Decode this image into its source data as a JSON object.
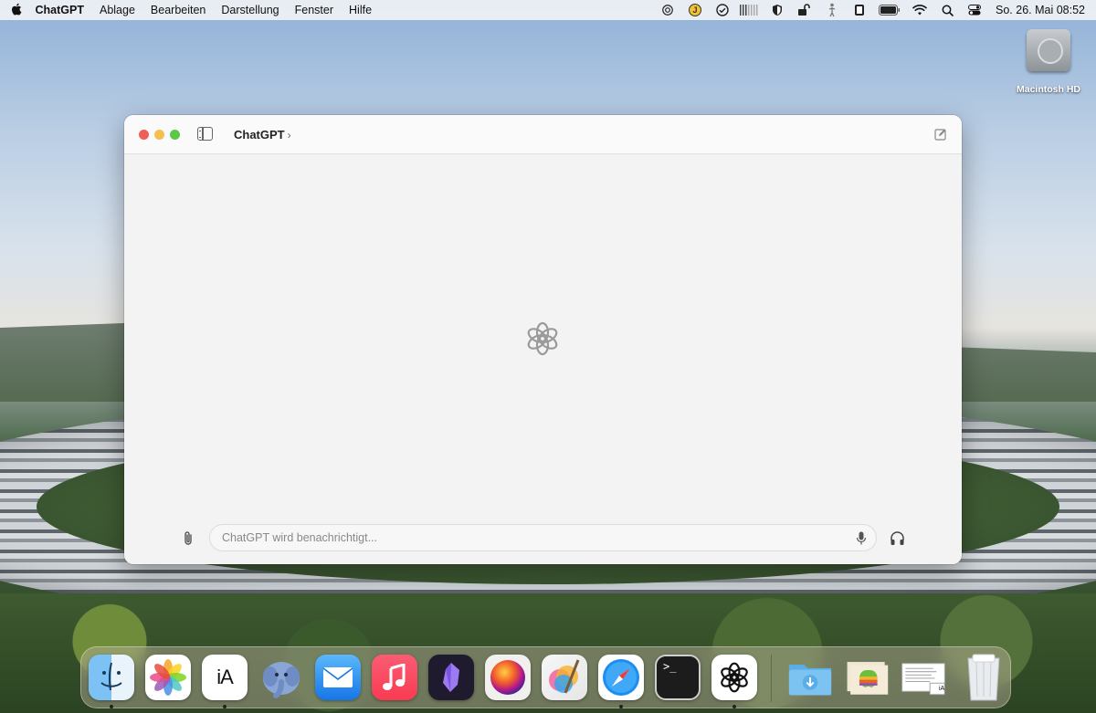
{
  "menubar": {
    "app_name": "ChatGPT",
    "items": [
      "Ablage",
      "Bearbeiten",
      "Darstellung",
      "Fenster",
      "Hilfe"
    ],
    "status_badge": "J",
    "clock": "So. 26. Mai  08:52"
  },
  "desktop": {
    "disk_label": "Macintosh HD"
  },
  "window": {
    "title": "ChatGPT",
    "title_chevron": "›",
    "composer_placeholder": "ChatGPT wird benachrichtigt..."
  },
  "dock": {
    "apps": [
      {
        "name": "Finder",
        "icon": "finder-icon",
        "running": true
      },
      {
        "name": "Fotos",
        "icon": "photos-icon",
        "running": false
      },
      {
        "name": "iA Writer",
        "icon": "ia-writer-icon",
        "glyph": "iA",
        "running": true
      },
      {
        "name": "TablePlus",
        "icon": "elephant-icon",
        "running": false
      },
      {
        "name": "Mail",
        "icon": "mail-icon",
        "running": false
      },
      {
        "name": "Musik",
        "icon": "music-icon",
        "running": false
      },
      {
        "name": "Obsidian",
        "icon": "obsidian-icon",
        "running": false
      },
      {
        "name": "macOS",
        "icon": "orb-icon",
        "running": false
      },
      {
        "name": "Pixelmator Pro",
        "icon": "pixelmator-icon",
        "running": false
      },
      {
        "name": "Safari",
        "icon": "safari-icon",
        "running": true
      },
      {
        "name": "Terminal",
        "icon": "terminal-icon",
        "glyph": ">_",
        "running": false
      },
      {
        "name": "ChatGPT",
        "icon": "chatgpt-icon",
        "running": true
      }
    ],
    "stacks": [
      {
        "name": "Downloads",
        "icon": "downloads-folder-icon"
      },
      {
        "name": "Apple Folder",
        "icon": "apple-folder-icon"
      },
      {
        "name": "Document",
        "icon": "document-stack-icon",
        "glyph": "iA"
      },
      {
        "name": "Papierkorb",
        "icon": "trash-icon"
      }
    ]
  }
}
